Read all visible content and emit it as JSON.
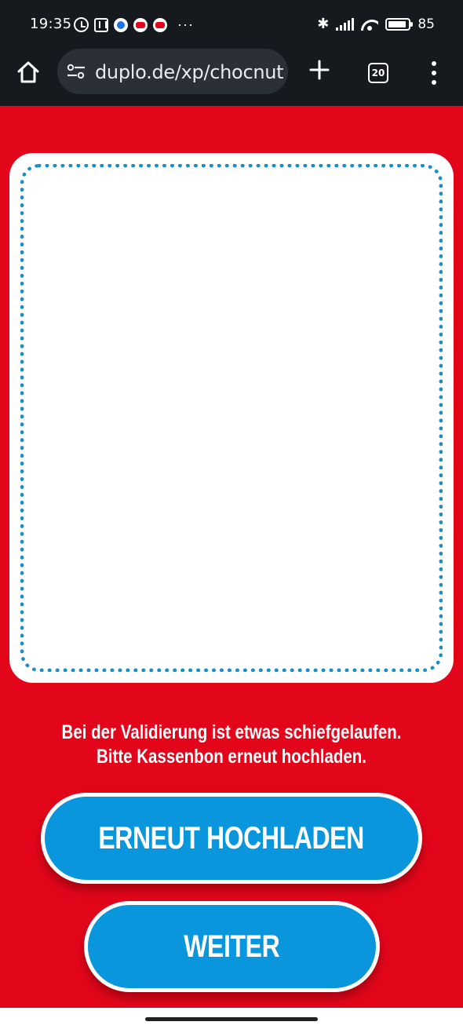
{
  "status_bar": {
    "time": "19:35",
    "more_indicator": "···",
    "battery": "85"
  },
  "browser": {
    "url": "duplo.de/xp/chocnut-",
    "tab_count": "20"
  },
  "page": {
    "error_message": "Bei der Validierung ist etwas schiefgelaufen. Bitte Kassenbon erneut hochladen.",
    "reupload_label": "ERNEUT HOCHLADEN",
    "next_label": "WEITER"
  },
  "colors": {
    "background": "#e3061b",
    "button": "#0a96dc",
    "dotted_border": "#1a8fc4"
  }
}
